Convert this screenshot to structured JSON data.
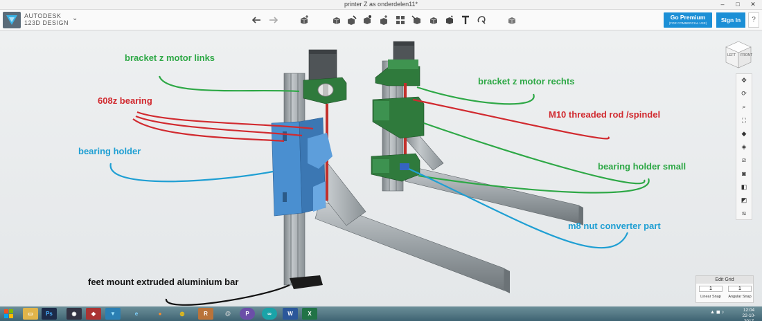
{
  "window": {
    "title": "printer Z as onderdelen11*",
    "minimize": "–",
    "maximize": "□",
    "close": "✕"
  },
  "app": {
    "brand_line1": "AUTODESK",
    "brand_line2": "123D DESIGN",
    "menu_caret": "⌄"
  },
  "toolbar": {
    "tools": [
      "undo",
      "redo",
      "primitives",
      "sketch",
      "construct",
      "modify",
      "pattern",
      "grouping",
      "combine",
      "measure",
      "text",
      "snap",
      "material"
    ]
  },
  "account": {
    "premium_label": "Go Premium",
    "premium_sub": "(FOR COMMERCIAL USE)",
    "signin_label": "Sign In",
    "help_label": "?"
  },
  "viewcube": {
    "left_face": "LEFT",
    "front_face": "FRONT"
  },
  "annotations": [
    {
      "text": "bracket z motor links",
      "color": "#2ea846"
    },
    {
      "text": "608z bearing",
      "color": "#d12a2f"
    },
    {
      "text": "bearing holder",
      "color": "#1f9fd3"
    },
    {
      "text": "feet mount extruded aluminium bar",
      "color": "#111111"
    },
    {
      "text": "bracket z motor rechts",
      "color": "#2ea846"
    },
    {
      "text": "M10 threaded rod /spindel",
      "color": "#d12a2f"
    },
    {
      "text": "bearing holder small",
      "color": "#2ea846"
    },
    {
      "text": "m8 nut converter part",
      "color": "#1f9fd3"
    }
  ],
  "nav_tools": [
    "pan",
    "orbit",
    "zoom",
    "fit",
    "views",
    "ortho",
    "materials",
    "hide",
    "screenshot",
    "snap",
    "grid"
  ],
  "grid_panel": {
    "title": "Edit Grid",
    "linear_value": "1",
    "angular_value": "1",
    "linear_label": "Linear Snap",
    "angular_label": "Angular Snap"
  },
  "taskbar": {
    "apps": [
      "explorer",
      "photoshop",
      "media-player",
      "3d-app",
      "123d-design",
      "ie",
      "firefox",
      "chrome",
      "r-app",
      "snail-app",
      "p-app",
      "arduino",
      "word",
      "excel"
    ],
    "clock_time": "12:04",
    "clock_date": "22-10-2017"
  },
  "colors": {
    "accent": "#1b8fd6",
    "part_green": "#3a8f4a",
    "part_blue": "#4a8fd0",
    "aluminium": "#9aa0a4",
    "rod": "#c2302c"
  }
}
